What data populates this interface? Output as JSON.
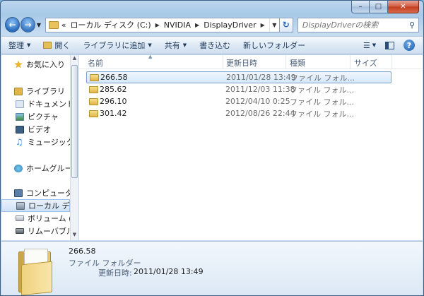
{
  "address": {
    "breadcrumbs": [
      "«",
      "ローカル ディスク (C:)",
      "NVIDIA",
      "DisplayDriver"
    ],
    "search_placeholder": "DisplayDriverの検索"
  },
  "toolbar": {
    "organize": "整理",
    "open": "開く",
    "add_to_library": "ライブラリに追加",
    "share": "共有",
    "burn": "書き込む",
    "new_folder": "新しいフォルダー"
  },
  "sidebar": {
    "items": [
      {
        "label": "お気に入り",
        "icon": "star-icon",
        "color": "#e8b42a"
      },
      {
        "label": "ライブラリ",
        "icon": "library-icon",
        "color": "#e0b548"
      },
      {
        "label": "ドキュメント",
        "icon": "documents-icon",
        "color": "#8fa9c7"
      },
      {
        "label": "ピクチャ",
        "icon": "pictures-icon",
        "color": "#5d9bd2"
      },
      {
        "label": "ビデオ",
        "icon": "video-icon",
        "color": "#3c5f86"
      },
      {
        "label": "ミュージック",
        "icon": "music-icon",
        "color": "#3a86d8"
      },
      {
        "label": "ホームグループ",
        "icon": "homegroup-icon",
        "color": "#3a9ad0"
      },
      {
        "label": "コンピューター",
        "icon": "computer-icon",
        "color": "#5a7ea8"
      },
      {
        "label": "ローカル ディ",
        "icon": "local-disk-icon",
        "color": "#8a9cb0"
      },
      {
        "label": "ボリューム (",
        "icon": "drive-icon",
        "color": "#b0b8c2"
      },
      {
        "label": "リムーバブル",
        "icon": "removable-drive-icon",
        "color": "#6c747d"
      }
    ]
  },
  "columns": {
    "name": "名前",
    "modified": "更新日時",
    "type": "種類",
    "size": "サイズ"
  },
  "files": [
    {
      "name": "266.58",
      "modified": "2011/01/28 13:49",
      "type": "ファイル フォル..."
    },
    {
      "name": "285.62",
      "modified": "2011/12/03 11:38",
      "type": "ファイル フォル..."
    },
    {
      "name": "296.10",
      "modified": "2012/04/10 0:25",
      "type": "ファイル フォル..."
    },
    {
      "name": "301.42",
      "modified": "2012/08/26 22:44",
      "type": "ファイル フォル..."
    }
  ],
  "details": {
    "name": "266.58",
    "type": "ファイル フォルダー",
    "date_label": "更新日時:",
    "date_value": "2011/01/28 13:49"
  }
}
